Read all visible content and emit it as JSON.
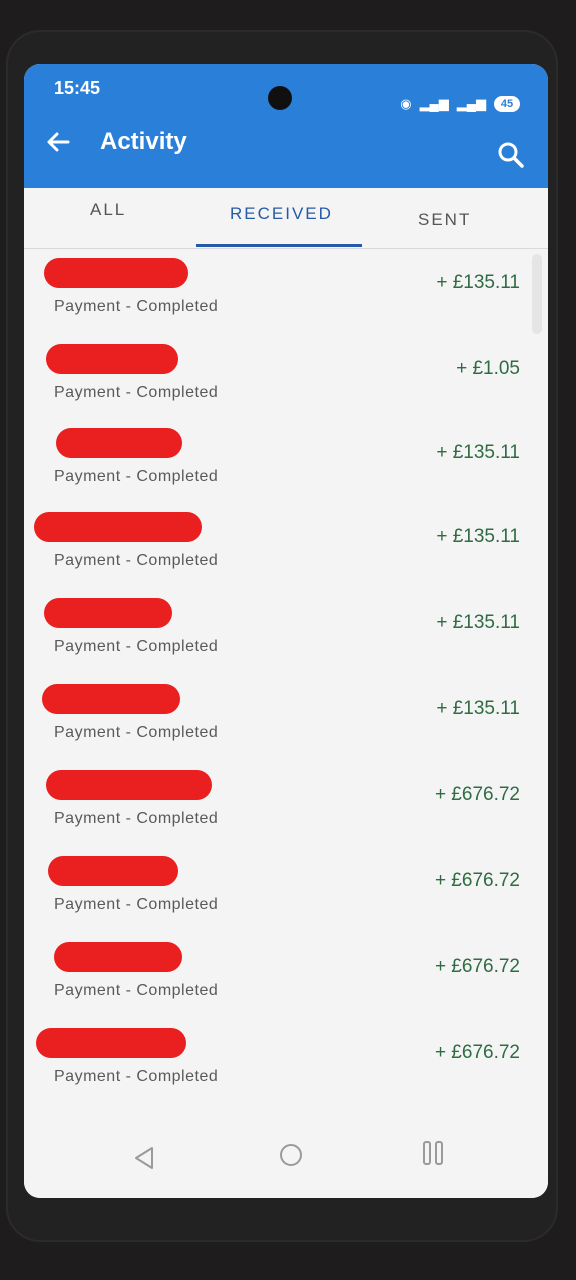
{
  "statusbar": {
    "time": "15:45",
    "battery": "45"
  },
  "toolbar": {
    "title": "Activity",
    "back_icon": "arrow-left-icon",
    "search_icon": "search-icon"
  },
  "tabs": [
    {
      "label": "ALL",
      "active": false
    },
    {
      "label": "RECEIVED",
      "active": true
    },
    {
      "label": "SENT",
      "active": false
    }
  ],
  "transactions": [
    {
      "status": "Payment - Completed",
      "amount": "+ £135.11"
    },
    {
      "status": "Payment - Completed",
      "amount": "+ £1.05"
    },
    {
      "status": "Payment - Completed",
      "amount": "+ £135.11"
    },
    {
      "status": "Payment - Completed",
      "amount": "+ £135.11"
    },
    {
      "status": "Payment - Completed",
      "amount": "+ £135.11"
    },
    {
      "status": "Payment - Completed",
      "amount": "+ £135.11"
    },
    {
      "status": "Payment - Completed",
      "amount": "+ £676.72"
    },
    {
      "status": "Payment - Completed",
      "amount": "+ £676.72"
    },
    {
      "status": "Payment - Completed",
      "amount": "+ £676.72"
    },
    {
      "status": "Payment - Completed",
      "amount": "+ £676.72"
    }
  ],
  "colors": {
    "appbar": "#2a7fd9",
    "accent": "#255aa8",
    "amount": "#2f6b43",
    "redaction": "#ea1f1f"
  }
}
